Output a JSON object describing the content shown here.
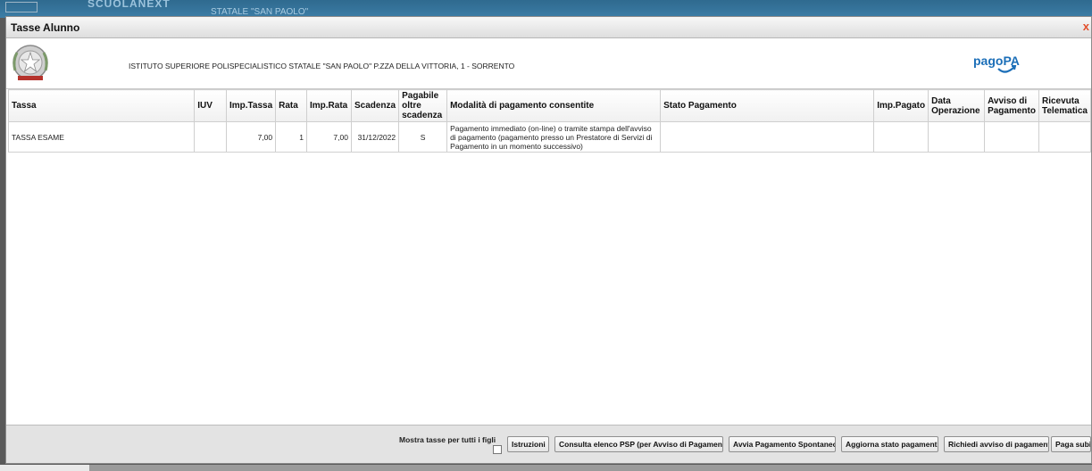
{
  "background_app": {
    "brand": "SCUOLANEXT",
    "school_label": "STATALE \"SAN PAOLO\""
  },
  "dialog": {
    "title": "Tasse Alunno",
    "close_glyph": "x"
  },
  "header": {
    "school_name": "ISTITUTO SUPERIORE POLISPECIALISTICO STATALE \"SAN PAOLO\" P.ZZA DELLA VITTORIA, 1 - SORRENTO",
    "pagopa_logo": "pagoPA"
  },
  "table": {
    "columns": [
      "Tassa",
      "IUV",
      "Imp.Tassa",
      "Rata",
      "Imp.Rata",
      "Scadenza",
      "Pagabile oltre scadenza",
      "Modalità di pagamento consentite",
      "Stato Pagamento",
      "Imp.Pagato",
      "Data Operazione",
      "Avviso di Pagamento",
      "Ricevuta Telematica"
    ],
    "rows": [
      {
        "tassa": "TASSA ESAME",
        "iuv": "",
        "imp_tassa": "7,00",
        "rata": "1",
        "imp_rata": "7,00",
        "scadenza": "31/12/2022",
        "pagabile_oltre": "S",
        "modalita": "Pagamento immediato (on-line) o tramite stampa dell'avviso di pagamento (pagamento presso un Prestatore di Servizi di Pagamento in un momento successivo)",
        "stato": "",
        "imp_pagato": "",
        "data_operazione": "",
        "avviso": "",
        "ricevuta": ""
      }
    ]
  },
  "footer": {
    "show_all_label": "Mostra tasse per tutti i figli",
    "show_all_checked": false,
    "buttons": [
      "Istruzioni",
      "Consulta elenco PSP (per Avviso di Pagamento)",
      "Avvia Pagamento Spontaneo",
      "Aggiorna stato pagamenti",
      "Richiedi avviso di pagamento",
      "Paga subito"
    ]
  },
  "colors": {
    "close": "#e2502d",
    "pagopa_blue": "#1c6fb8",
    "app_bar": "#2f6a8f"
  }
}
